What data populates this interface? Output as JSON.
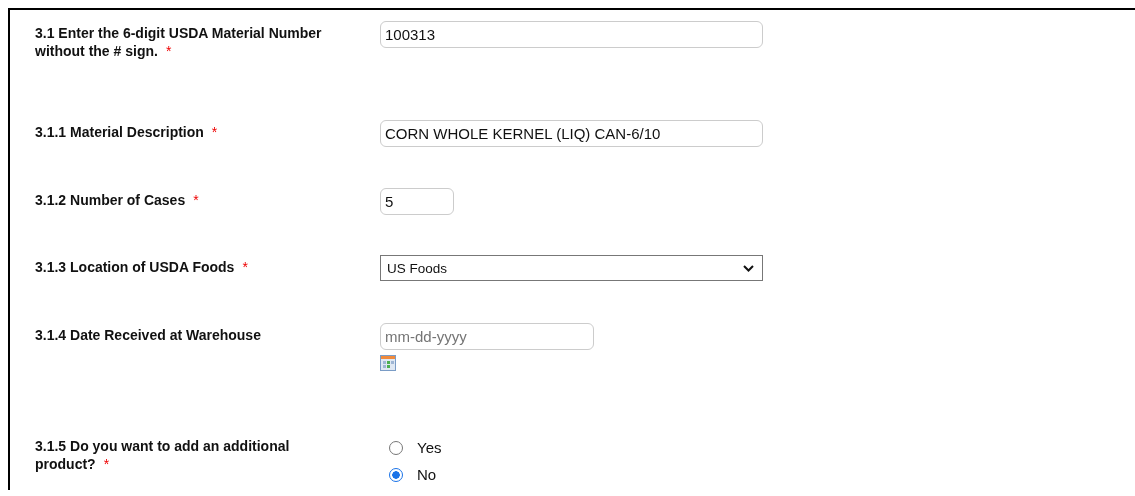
{
  "questions": [
    {
      "label": "3.1 Enter the 6-digit USDA Material Number without the # sign.",
      "required_mark": "*",
      "kind": "text",
      "value": "100313"
    },
    {
      "label": "3.1.1 Material Description",
      "required_mark": "*",
      "kind": "text",
      "value": "CORN WHOLE KERNEL (LIQ) CAN-6/10"
    },
    {
      "label": "3.1.2 Number of Cases",
      "required_mark": "*",
      "kind": "number",
      "value": "5"
    },
    {
      "label": "3.1.3 Location of USDA Foods",
      "required_mark": "*",
      "kind": "select",
      "value": "US Foods"
    },
    {
      "label": "3.1.4 Date Received at Warehouse",
      "kind": "date",
      "placeholder": "mm-dd-yyyy"
    },
    {
      "label": "3.1.5 Do you want to add an additional product?",
      "required_mark": "*",
      "kind": "radio",
      "options": [
        {
          "label": "Yes",
          "selected": false
        },
        {
          "label": "No",
          "selected": true
        }
      ]
    }
  ]
}
